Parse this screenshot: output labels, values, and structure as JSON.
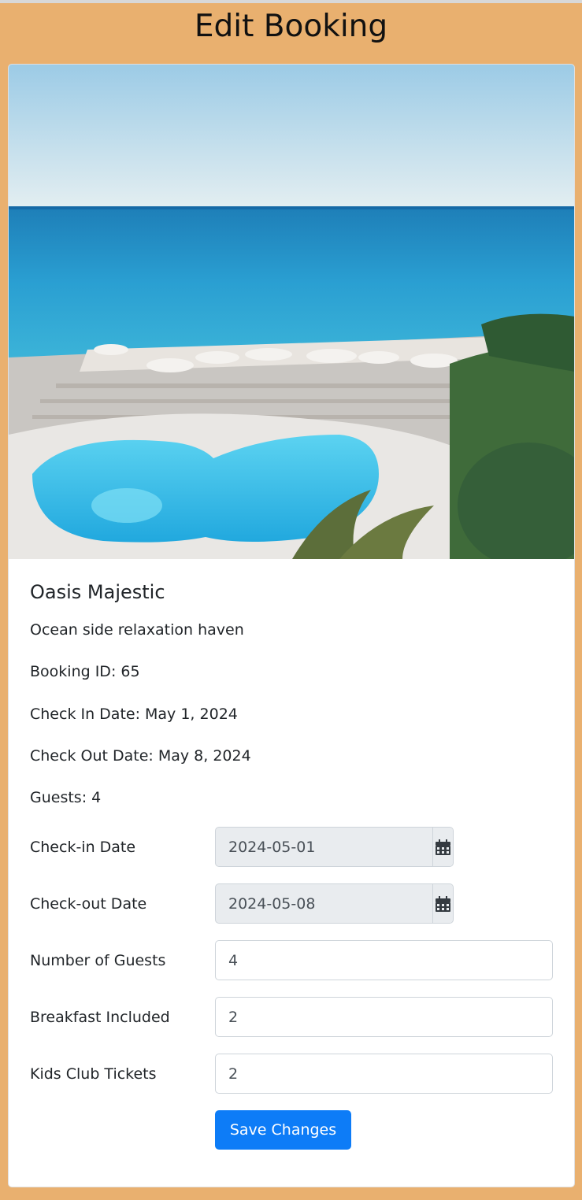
{
  "header": {
    "title": "Edit Booking"
  },
  "hotel": {
    "name": "Oasis Majestic",
    "description": "Ocean side relaxation haven"
  },
  "booking": {
    "id_text": "Booking ID: 65",
    "check_in_text": "Check In Date: May 1, 2024",
    "check_out_text": "Check Out Date: May 8, 2024",
    "guests_text": "Guests: 4"
  },
  "form": {
    "check_in": {
      "label": "Check-in Date",
      "value": "2024-05-01",
      "icon": "calendar-icon"
    },
    "check_out": {
      "label": "Check-out Date",
      "value": "2024-05-08",
      "icon": "calendar-icon"
    },
    "guests": {
      "label": "Number of Guests",
      "value": "4"
    },
    "breakfast": {
      "label": "Breakfast Included",
      "value": "2"
    },
    "kids_club": {
      "label": "Kids Club Tickets",
      "value": "2"
    },
    "save_label": "Save Changes"
  },
  "colors": {
    "page_background": "#e9b06f",
    "primary_button": "#0d7cf7",
    "readonly_input": "#e9ecef"
  }
}
